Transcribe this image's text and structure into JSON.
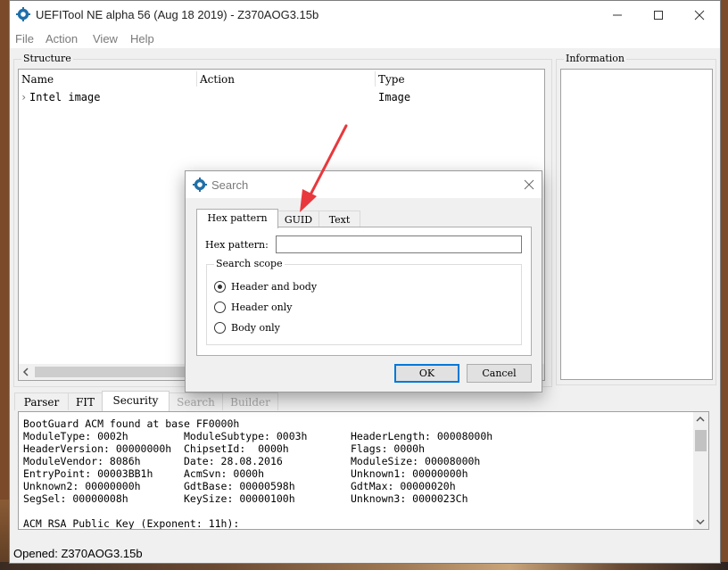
{
  "window": {
    "title": "UEFITool NE alpha 56 (Aug 18 2019) - Z370AOG3.15b"
  },
  "menu": [
    "File",
    "Action",
    "View",
    "Help"
  ],
  "structure": {
    "title": "Structure",
    "columns": [
      "Name",
      "Action",
      "Type"
    ],
    "rows": [
      {
        "name": "Intel image",
        "action": "",
        "type": "Image",
        "expander": "›"
      }
    ]
  },
  "information": {
    "title": "Information"
  },
  "bottom_tabs": [
    {
      "label": "Parser",
      "state": "normal"
    },
    {
      "label": "FIT",
      "state": "normal"
    },
    {
      "label": "Security",
      "state": "active"
    },
    {
      "label": "Search",
      "state": "disabled"
    },
    {
      "label": "Builder",
      "state": "disabled"
    }
  ],
  "log": {
    "lines": [
      "BootGuard ACM found at base FF0000h",
      "ModuleType: 0002h         ModuleSubtype: 0003h       HeaderLength: 00008000h",
      "HeaderVersion: 00000000h  ChipsetId:  0000h          Flags: 0000h",
      "ModuleVendor: 8086h       Date: 28.08.2016           ModuleSize: 00008000h",
      "EntryPoint: 00003BB1h     AcmSvn: 0000h              Unknown1: 00000000h",
      "Unknown2: 00000000h       GdtBase: 00000598h         GdtMax: 00000020h",
      "SegSel: 00000008h         KeySize: 00000100h         Unknown3: 0000023Ch",
      "",
      "ACM RSA Public Key (Exponent: 11h):"
    ]
  },
  "status": {
    "text": "Opened: Z370AOG3.15b"
  },
  "dialog": {
    "title": "Search",
    "tabs": [
      "Hex pattern",
      "GUID",
      "Text"
    ],
    "active_tab": "Hex pattern",
    "hex_label": "Hex pattern:",
    "hex_value": "",
    "scope_title": "Search scope",
    "scope_options": [
      "Header and body",
      "Header only",
      "Body only"
    ],
    "scope_selected": "Header and body",
    "ok_label": "OK",
    "cancel_label": "Cancel"
  },
  "colors": {
    "accent": "#0078d7",
    "annotation_arrow": "#e8383d"
  }
}
